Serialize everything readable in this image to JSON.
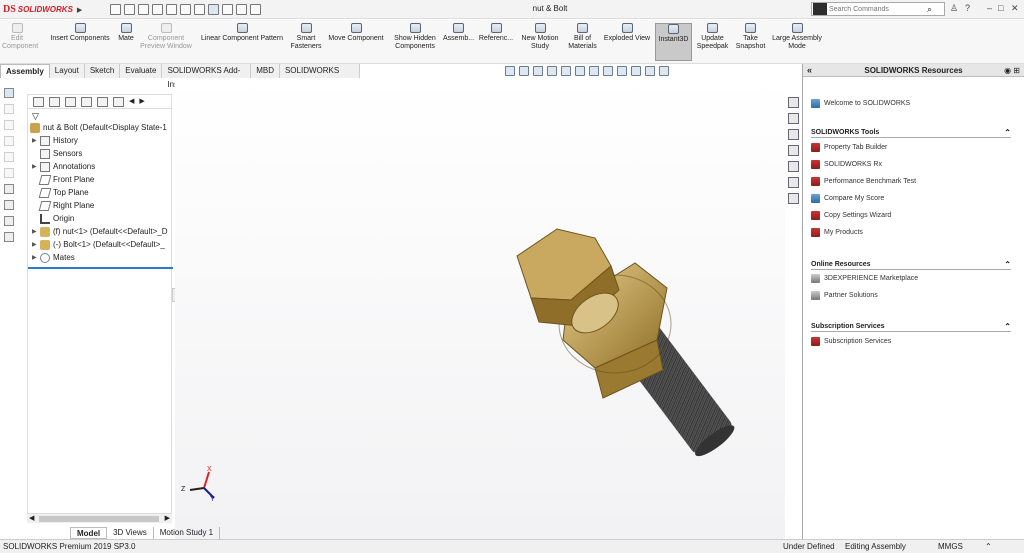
{
  "titlebar": {
    "brand": "SOLIDWORKS",
    "doc_title": "nut & Bolt",
    "search_placeholder": "Search Commands",
    "help_label": "?"
  },
  "commands": [
    {
      "label1": "Edit",
      "label2": "Component",
      "disabled": true,
      "icon": "edit-component-icon"
    },
    {
      "label1": "Insert Components",
      "label2": "",
      "disabled": false,
      "icon": "insert-components-icon"
    },
    {
      "label1": "Mate",
      "label2": "",
      "disabled": false,
      "icon": "mate-icon"
    },
    {
      "label1": "Component",
      "label2": "Preview Window",
      "disabled": true,
      "icon": "component-preview-icon"
    },
    {
      "label1": "Linear Component Pattern",
      "label2": "",
      "disabled": false,
      "icon": "linear-pattern-icon"
    },
    {
      "label1": "Smart",
      "label2": "Fasteners",
      "disabled": false,
      "icon": "smart-fasteners-icon"
    },
    {
      "label1": "Move Component",
      "label2": "",
      "disabled": false,
      "icon": "move-component-icon"
    },
    {
      "label1": "Show Hidden",
      "label2": "Components",
      "disabled": false,
      "icon": "show-hidden-icon"
    },
    {
      "label1": "Assemb...",
      "label2": "",
      "disabled": false,
      "icon": "assembly-features-icon"
    },
    {
      "label1": "Referenc...",
      "label2": "",
      "disabled": false,
      "icon": "reference-geometry-icon"
    },
    {
      "label1": "New Motion",
      "label2": "Study",
      "disabled": false,
      "icon": "motion-study-icon"
    },
    {
      "label1": "Bill of",
      "label2": "Materials",
      "disabled": false,
      "icon": "bill-of-materials-icon"
    },
    {
      "label1": "Exploded View",
      "label2": "",
      "disabled": false,
      "icon": "exploded-view-icon"
    },
    {
      "label1": "Instant3D",
      "label2": "",
      "disabled": false,
      "active": true,
      "icon": "instant3d-icon"
    },
    {
      "label1": "Update",
      "label2": "Speedpak",
      "disabled": false,
      "icon": "speedpak-icon"
    },
    {
      "label1": "Take",
      "label2": "Snapshot",
      "disabled": false,
      "icon": "snapshot-icon"
    },
    {
      "label1": "Large Assembly",
      "label2": "Mode",
      "disabled": false,
      "icon": "large-assembly-icon"
    }
  ],
  "tabs": [
    "Assembly",
    "Layout",
    "Sketch",
    "Evaluate",
    "SOLIDWORKS Add-Ins",
    "MBD",
    "SOLIDWORKS CAM"
  ],
  "tree": {
    "filter": "▽",
    "items": [
      {
        "label": "nut & Bolt  (Default<Display State-1",
        "icon": "assembly-icon",
        "expand": false
      },
      {
        "label": "History",
        "icon": "history-icon",
        "expand": true
      },
      {
        "label": "Sensors",
        "icon": "sensors-icon",
        "expand": false
      },
      {
        "label": "Annotations",
        "icon": "annotations-icon",
        "expand": true
      },
      {
        "label": "Front Plane",
        "icon": "plane-icon",
        "expand": false
      },
      {
        "label": "Top Plane",
        "icon": "plane-icon",
        "expand": false
      },
      {
        "label": "Right Plane",
        "icon": "plane-icon",
        "expand": false
      },
      {
        "label": "Origin",
        "icon": "origin-icon",
        "expand": false
      },
      {
        "label": "(f) nut<1> (Default<<Default>_D",
        "icon": "part-icon",
        "expand": true
      },
      {
        "label": "(-) Bolt<1> (Default<<Default>_",
        "icon": "part-icon",
        "expand": true
      },
      {
        "label": "Mates",
        "icon": "mates-icon",
        "expand": true
      }
    ]
  },
  "bottom_tabs": [
    "Model",
    "3D Views",
    "Motion Study 1"
  ],
  "status": {
    "product": "SOLIDWORKS Premium 2019 SP3.0",
    "state": "Under Defined",
    "mode": "Editing Assembly",
    "units": "MMGS"
  },
  "triad": {
    "x": "X",
    "y": "Y",
    "z": "Z"
  },
  "resources": {
    "title": "SOLIDWORKS Resources",
    "welcome": "Welcome to SOLIDWORKS",
    "sections": [
      {
        "title": "SOLIDWORKS Tools",
        "items": [
          "Property Tab Builder",
          "SOLIDWORKS Rx",
          "Performance Benchmark Test",
          "Compare My Score",
          "Copy Settings Wizard",
          "My Products"
        ]
      },
      {
        "title": "Online Resources",
        "items": [
          "3DEXPERIENCE Marketplace",
          "Partner Solutions"
        ]
      },
      {
        "title": "Subscription Services",
        "items": [
          "Subscription Services"
        ]
      }
    ]
  },
  "colors": {
    "accent": "#2a7ad3",
    "brand": "#d21f26",
    "brass": "#b8963f",
    "bolt": "#3c3c3c"
  }
}
